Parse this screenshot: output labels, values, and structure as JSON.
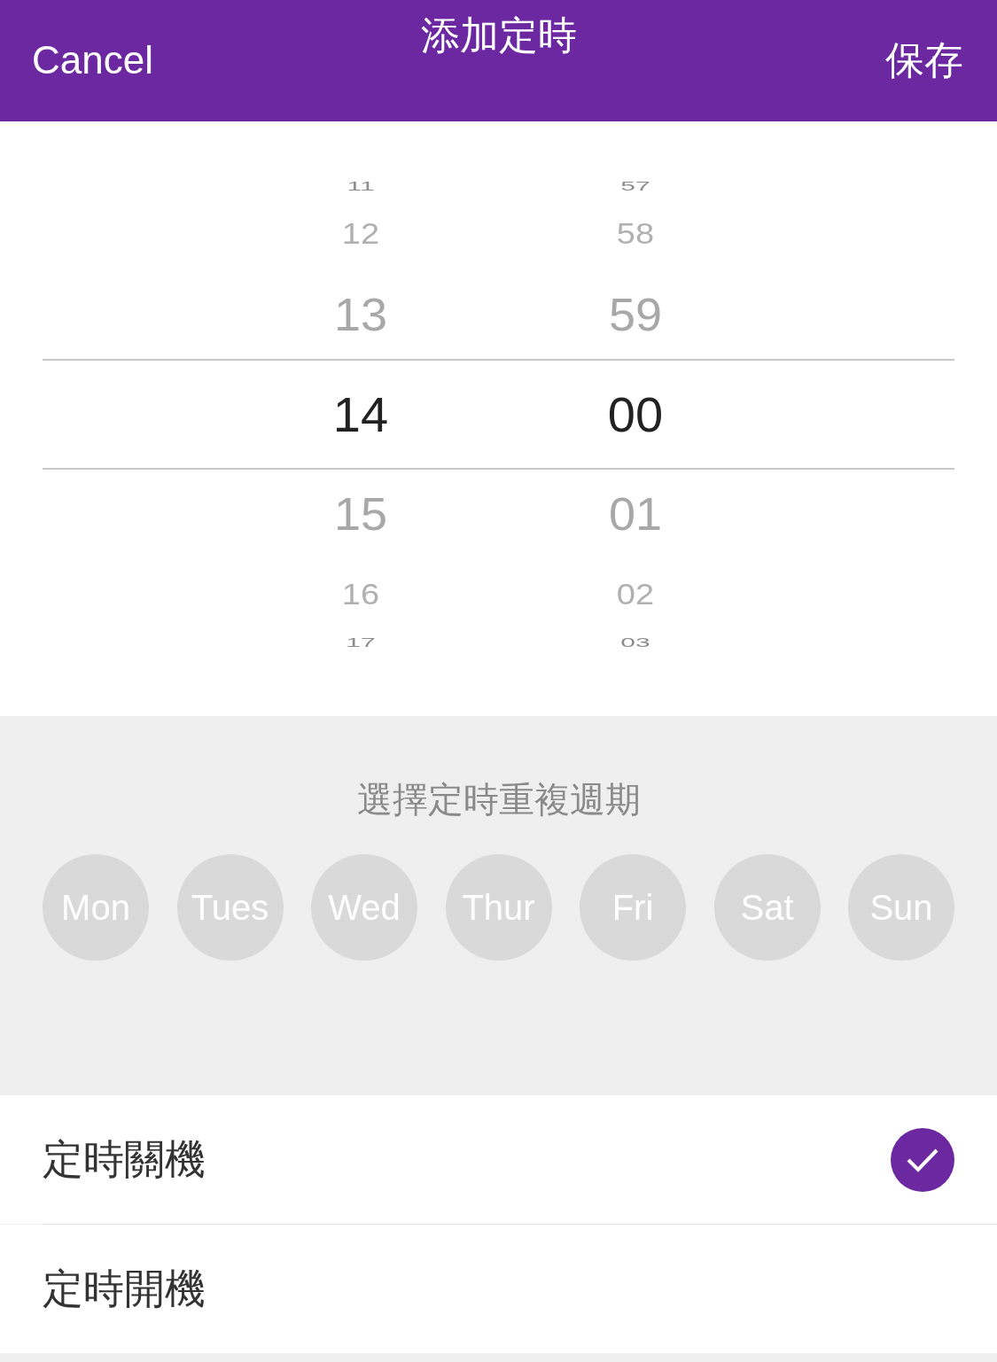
{
  "header": {
    "cancel": "Cancel",
    "title": "添加定時",
    "save": "保存"
  },
  "picker": {
    "columns": [
      {
        "items": [
          {
            "text": "11",
            "selected": false
          },
          {
            "text": "12",
            "selected": false
          },
          {
            "text": "13",
            "selected": false
          },
          {
            "text": "14",
            "selected": true
          },
          {
            "text": "15",
            "selected": false
          },
          {
            "text": "16",
            "selected": false
          },
          {
            "text": "17",
            "selected": false
          }
        ]
      },
      {
        "items": [
          {
            "text": "57",
            "selected": false
          },
          {
            "text": "58",
            "selected": false
          },
          {
            "text": "59",
            "selected": false
          },
          {
            "text": "00",
            "selected": true
          },
          {
            "text": "01",
            "selected": false
          },
          {
            "text": "02",
            "selected": false
          },
          {
            "text": "03",
            "selected": false
          }
        ]
      }
    ]
  },
  "repeat": {
    "title": "選擇定時重複週期",
    "days": [
      {
        "label": "Mon",
        "selected": false
      },
      {
        "label": "Tues",
        "selected": false
      },
      {
        "label": "Wed",
        "selected": false
      },
      {
        "label": "Thur",
        "selected": false
      },
      {
        "label": "Fri",
        "selected": false
      },
      {
        "label": "Sat",
        "selected": false
      },
      {
        "label": "Sun",
        "selected": false
      }
    ]
  },
  "options": [
    {
      "label": "定時關機",
      "checked": true
    },
    {
      "label": "定時開機",
      "checked": false
    }
  ]
}
